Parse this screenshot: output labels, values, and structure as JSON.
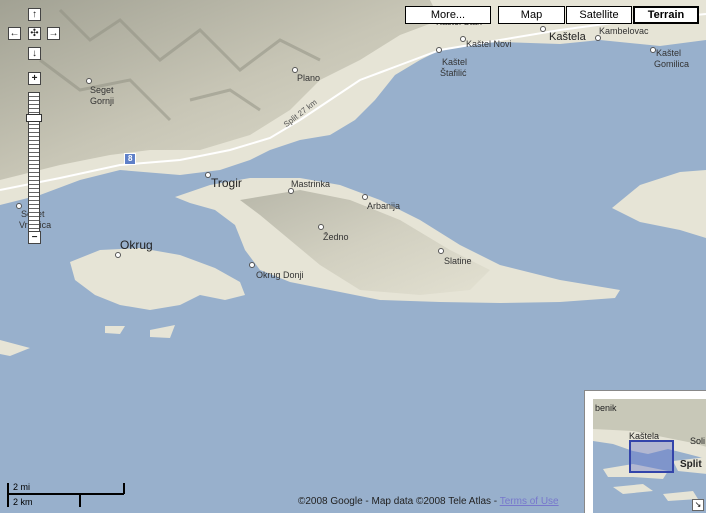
{
  "controls": {
    "pan_up": "↑",
    "pan_left": "←",
    "pan_center": "✣",
    "pan_right": "→",
    "pan_down": "↓",
    "zoom_in": "+",
    "zoom_out": "−",
    "zoom_level_fraction": 0.17
  },
  "map_types": {
    "more": "More...",
    "map": "Map",
    "satellite": "Satellite",
    "terrain": "Terrain",
    "active": "Terrain"
  },
  "places": {
    "seget_gornji_1": "Seget",
    "seget_gornji_2": "Gornji",
    "plano": "Plano",
    "kastel_stari": "Kaštel Stari",
    "kastel_novi": "Kaštel Novi",
    "kastela": "Kaštela",
    "kambelovac": "Kambelovac",
    "kastel_stafilic_1": "Kaštel",
    "kastel_stafilic_2": "Štafilić",
    "kastel_gomilica_1": "Kaštel",
    "kastel_gomilica_2": "Gomilica",
    "trogir": "Trogir",
    "mastrinka": "Mastrinka",
    "arbanija": "Arbanija",
    "zedno": "Žedno",
    "slatine": "Slatine",
    "okrug": "Okrug",
    "okrug_donji": "Okrug Donji",
    "seget_vranjica_1": "Seget",
    "seget_vranjica_2": "Vranjica",
    "road_label": "Split 27 km",
    "road_shield": "8"
  },
  "scale": {
    "miles": "2 mi",
    "km": "2 km"
  },
  "footer": {
    "copyright": "©2008 Google - Map data ©2008 Tele Atlas - ",
    "terms_link": "Terms of Use"
  },
  "overview": {
    "benik": "benik",
    "kastela": "Kaštela",
    "solin": "Soli",
    "split": "Split"
  },
  "colors": {
    "water": "#98b0cc",
    "land": "#e8e6d8",
    "hills": "#b8b8a8",
    "road": "#ffffff",
    "viewport": "#3344aa"
  }
}
